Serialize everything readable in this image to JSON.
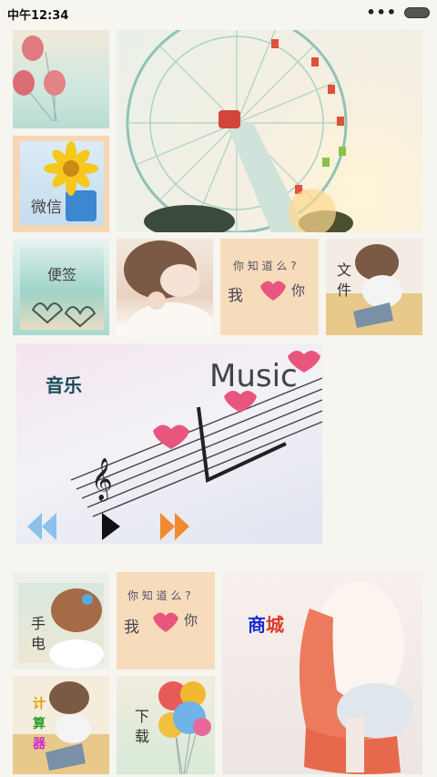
{
  "status_bar": {
    "time": "中午12:34",
    "more": "•••"
  },
  "tiles": {
    "weixin": "微信",
    "bianqian": "便签",
    "wenjian": [
      "文",
      "件"
    ],
    "music_title": "音乐",
    "music_word": "Music",
    "shoudian": [
      "手",
      "电"
    ],
    "shangcheng": "商城",
    "jisuanqi": [
      "计",
      "算",
      "器"
    ],
    "xiazai": [
      "下",
      "载"
    ]
  },
  "colors": {
    "heart": "#e8567e",
    "prev_arrow": "#7ab8ea",
    "play": "#111111",
    "next_arrow": "#f08a2c",
    "shangcheng_shang": "#1a2fd0",
    "shangcheng_cheng": "#e03a2a",
    "jisuanqi": [
      "#e0a000",
      "#2aa02a",
      "#d02ad0"
    ]
  }
}
